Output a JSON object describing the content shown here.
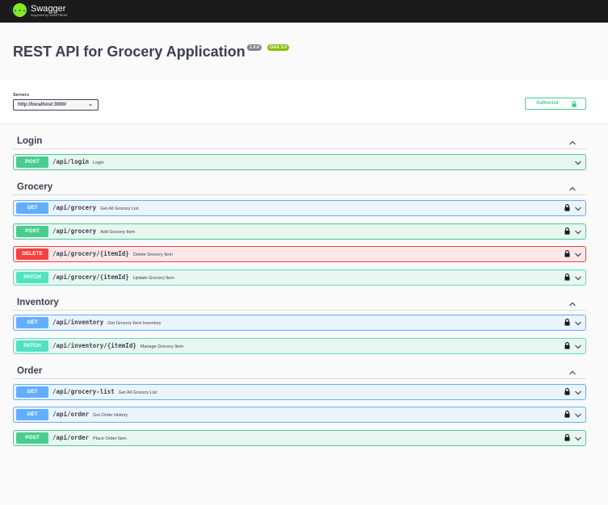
{
  "topbar": {
    "logo_glyph": "{...}",
    "brand": "Swagger",
    "subbrand": "Supported by SMARTBEAR"
  },
  "info": {
    "title": "REST API for Grocery Application",
    "version": "1.0.0",
    "oas": "OAS 3.0"
  },
  "servers": {
    "label": "Servers",
    "selected": "http://localhost:3000/"
  },
  "authorize": {
    "label": "Authorize",
    "icon": "lock-icon"
  },
  "colors": {
    "post": "#49cc90",
    "get": "#61affe",
    "delete": "#f93e3e",
    "patch": "#50e3c2",
    "topbar": "#1b1b1b"
  },
  "tags": [
    {
      "name": "Login",
      "operations": [
        {
          "method": "POST",
          "path": "/api/login",
          "summary": "Login",
          "locked": false
        }
      ]
    },
    {
      "name": "Grocery",
      "operations": [
        {
          "method": "GET",
          "path": "/api/grocery",
          "summary": "Get All Grocery List",
          "locked": true
        },
        {
          "method": "POST",
          "path": "/api/grocery",
          "summary": "Add Grocery Item",
          "locked": true
        },
        {
          "method": "DELETE",
          "path": "/api/grocery/{itemId}",
          "summary": "Delete Grocery Item",
          "locked": true
        },
        {
          "method": "PATCH",
          "path": "/api/grocery/{itemId}",
          "summary": "Update Grocery Item",
          "locked": true
        }
      ]
    },
    {
      "name": "Inventory",
      "operations": [
        {
          "method": "GET",
          "path": "/api/inventory",
          "summary": "Get Grocery Item Inventory",
          "locked": true
        },
        {
          "method": "PATCH",
          "path": "/api/inventory/{itemId}",
          "summary": "Manage Grocery Item",
          "locked": true
        }
      ]
    },
    {
      "name": "Order",
      "operations": [
        {
          "method": "GET",
          "path": "/api/grocery-list",
          "summary": "Get All Grocery List",
          "locked": true
        },
        {
          "method": "GET",
          "path": "/api/order",
          "summary": "Get Order History",
          "locked": true
        },
        {
          "method": "POST",
          "path": "/api/order",
          "summary": "Place Order Item",
          "locked": true
        }
      ]
    }
  ]
}
